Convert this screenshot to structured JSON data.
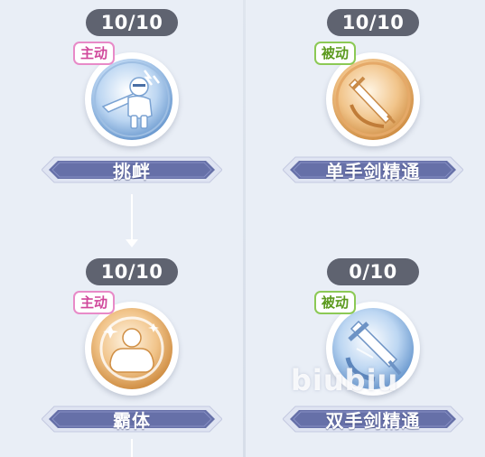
{
  "watermark": "biubiu",
  "skills": [
    {
      "level": "10/10",
      "type": "主动",
      "name": "挑衅",
      "icon": "taunt-swordsman-icon",
      "theme": "blue"
    },
    {
      "level": "10/10",
      "type": "被动",
      "name": "单手剑精通",
      "icon": "one-hand-sword-mastery-icon",
      "theme": "gold"
    },
    {
      "level": "10/10",
      "type": "主动",
      "name": "霸体",
      "icon": "super-armor-icon",
      "theme": "gold"
    },
    {
      "level": "0/10",
      "type": "被动",
      "name": "双手剑精通",
      "icon": "two-hand-sword-mastery-icon",
      "theme": "blue"
    }
  ],
  "colors": {
    "background": "#e9eef6",
    "level_pill": "#5f6370",
    "active_badge": "#d0479b",
    "passive_badge": "#5c9a1e",
    "banner": "#6670a8"
  }
}
